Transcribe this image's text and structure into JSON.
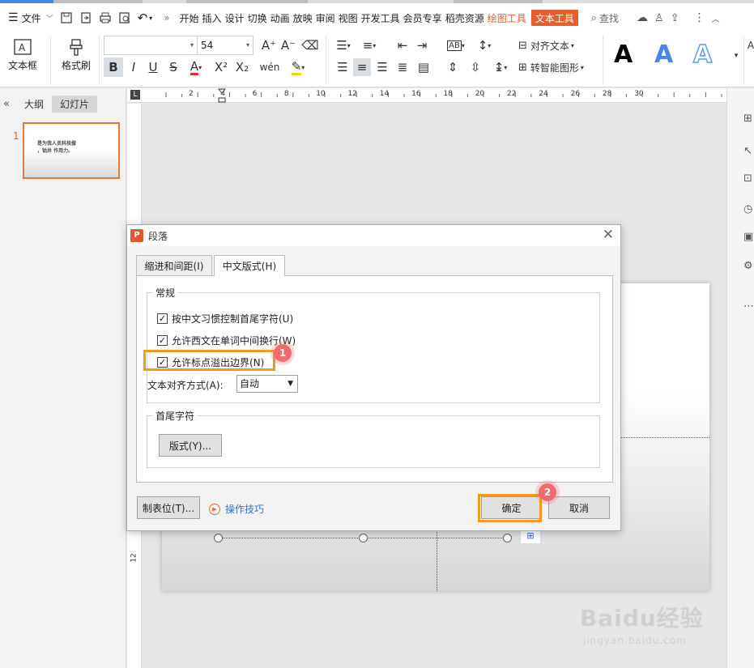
{
  "menubar": {
    "file_label": "文件",
    "tabs": [
      "开始",
      "插入",
      "设计",
      "切换",
      "动画",
      "放映",
      "审阅",
      "视图",
      "开发工具",
      "会员专享",
      "稻壳资源"
    ],
    "drawing_tools_label": "绘图工具",
    "text_tools_label": "文本工具",
    "search_label": "查找",
    "more_label": "»"
  },
  "ribbon": {
    "textbox_label": "文本框",
    "format_painter_label": "格式刷",
    "font_name": "",
    "font_size": "54",
    "align_text_label": "对齐文本",
    "smartart_label": "转智能图形",
    "style_glyph": "A"
  },
  "left_pane": {
    "tabs": [
      "大纲",
      "幻灯片"
    ],
    "slide_number": "1",
    "thumb_text": "是为我人员科技做\n，钴井 作用力。"
  },
  "ruler": {
    "numbers": [
      "2",
      "4",
      "6",
      "8",
      "10",
      "12",
      "14",
      "16",
      "18",
      "20",
      "22",
      "24",
      "26",
      "28",
      "30"
    ],
    "vertical_numbers": [
      "12"
    ]
  },
  "dialog": {
    "title": "段落",
    "tabs": [
      "缩进和间距(I)",
      "中文版式(H)"
    ],
    "general_group": "常规",
    "checkbox_1": "按中文习惯控制首尾字符(U)",
    "checkbox_2": "允许西文在单词中间换行(W)",
    "checkbox_3": "允许标点溢出边界(N)",
    "align_label": "文本对齐方式(A):",
    "align_value": "自动",
    "first_last_group": "首尾字符",
    "layout_button": "版式(Y)...",
    "tabs_button": "制表位(T)...",
    "tips_link": "操作技巧",
    "ok_button": "确定",
    "cancel_button": "取消"
  },
  "badges": [
    "1",
    "2"
  ],
  "watermark": {
    "main": "Baidu经验",
    "sub": "jingyan.baidu.com"
  },
  "colors": {
    "accent": "#e35f2e",
    "highlight": "#f39a1e",
    "badge": "#f06b6b",
    "link": "#3672c4"
  }
}
